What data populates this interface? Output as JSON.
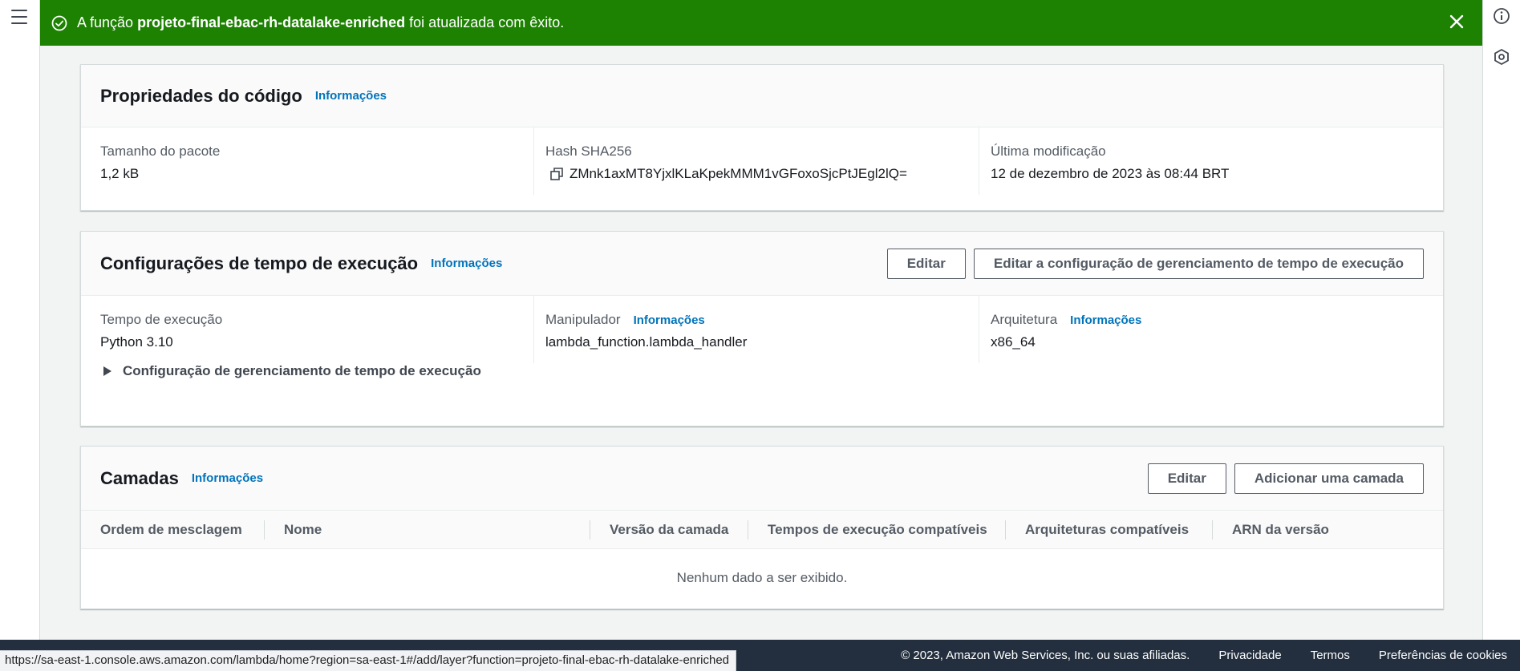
{
  "flash": {
    "prefix": "A função",
    "function_name": "projeto-final-ebac-rh-datalake-enriched",
    "suffix": "foi atualizada com êxito."
  },
  "code_properties": {
    "title": "Propriedades do código",
    "info": "Informações",
    "fields": [
      {
        "label": "Tamanho do pacote",
        "value": "1,2 kB"
      },
      {
        "label": "Hash SHA256",
        "value": "ZMnk1axMT8YjxlKLaKpekMMM1vGFoxoSjcPtJEgl2lQ="
      },
      {
        "label": "Última modificação",
        "value": "12 de dezembro de 2023 às 08:44 BRT"
      }
    ]
  },
  "runtime": {
    "title": "Configurações de tempo de execução",
    "info": "Informações",
    "edit_button": "Editar",
    "edit_mgmt_button": "Editar a configuração de gerenciamento de tempo de execução",
    "fields": [
      {
        "label": "Tempo de execução",
        "value": "Python 3.10",
        "info": ""
      },
      {
        "label": "Manipulador",
        "value": "lambda_function.lambda_handler",
        "info": "Informações"
      },
      {
        "label": "Arquitetura",
        "value": "x86_64",
        "info": "Informações"
      }
    ],
    "expander": "Configuração de gerenciamento de tempo de execução"
  },
  "layers": {
    "title": "Camadas",
    "info": "Informações",
    "edit_button": "Editar",
    "add_button": "Adicionar uma camada",
    "columns": [
      "Ordem de mesclagem",
      "Nome",
      "Versão da camada",
      "Tempos de execução compatíveis",
      "Arquiteturas compatíveis",
      "ARN da versão"
    ],
    "empty_message": "Nenhum dado a ser exibido."
  },
  "footer": {
    "copyright": "© 2023, Amazon Web Services, Inc. ou suas afiliadas.",
    "privacy": "Privacidade",
    "terms": "Termos",
    "cookies": "Preferências de cookies"
  },
  "status_bar": {
    "url": "https://sa-east-1.console.aws.amazon.com/lambda/home?region=sa-east-1#/add/layer?function=projeto-final-ebac-rh-datalake-enriched"
  },
  "colors": {
    "success": "#1d8102",
    "link": "#0073bb",
    "footer_bg": "#232f3e"
  }
}
